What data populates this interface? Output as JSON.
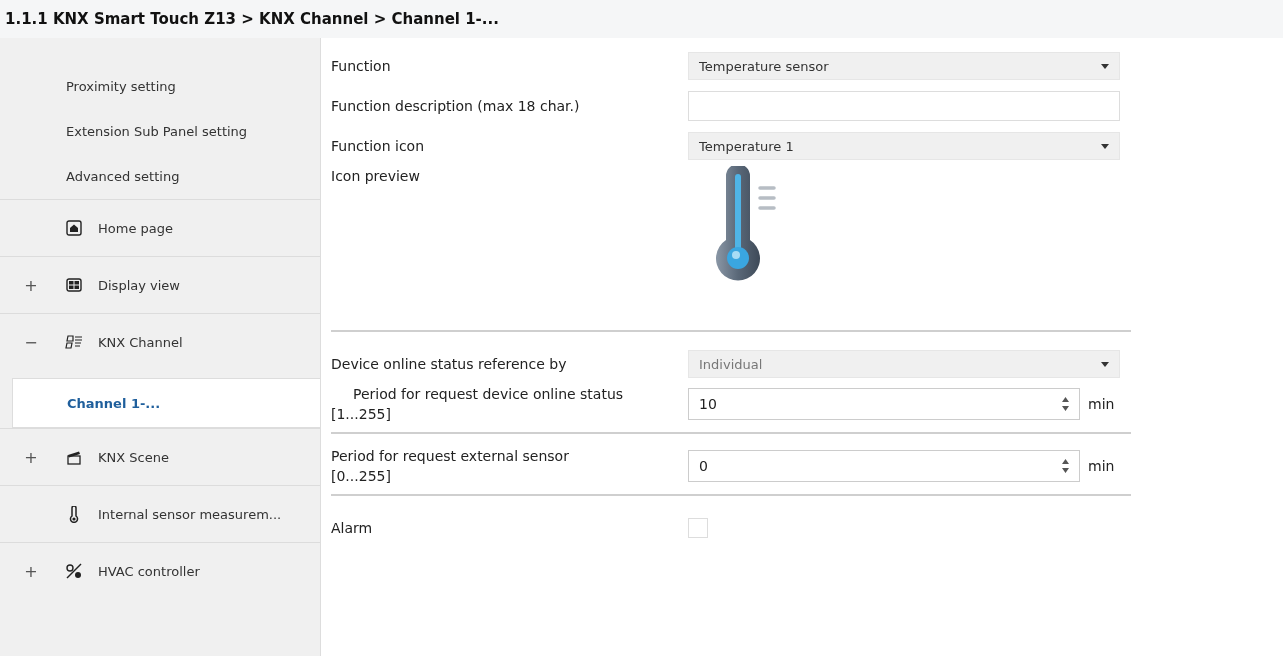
{
  "breadcrumb": "1.1.1 KNX Smart Touch Z13 > KNX Channel  > Channel 1-...",
  "sidebar": {
    "items": [
      {
        "kind": "sub",
        "label": "Proximity setting",
        "selected": false
      },
      {
        "kind": "sub",
        "label": "Extension Sub Panel setting",
        "selected": false
      },
      {
        "kind": "sub",
        "label": "Advanced setting",
        "selected": false
      },
      {
        "kind": "node",
        "label": "Home page",
        "selected": false
      },
      {
        "kind": "node",
        "label": "Display view",
        "expander": "+",
        "selected": false
      },
      {
        "kind": "node",
        "label": "KNX Channel",
        "expander": "−",
        "selected": false
      },
      {
        "kind": "sub",
        "label": "Channel 1-...",
        "selected": true
      },
      {
        "kind": "node",
        "label": "KNX Scene",
        "expander": "+",
        "selected": false
      },
      {
        "kind": "node",
        "label": "Internal sensor measurem...",
        "selected": false
      },
      {
        "kind": "node",
        "label": "HVAC controller",
        "expander": "+",
        "selected": false
      }
    ]
  },
  "sections": [
    [
      {
        "kind": "dropdown",
        "label": "Function",
        "value": "Temperature sensor",
        "disabled": false
      },
      {
        "kind": "text",
        "label": "Function description (max 18 char.)"
      },
      {
        "kind": "dropdown",
        "label": "Function icon",
        "value": "Temperature 1",
        "disabled": false
      },
      {
        "kind": "preview",
        "label": "Icon preview"
      }
    ],
    [
      {
        "kind": "dropdown",
        "label": "Device online status reference by",
        "value": "Individual",
        "disabled": true
      },
      {
        "kind": "number",
        "label": "Period for request device online status",
        "range": "[1...255]",
        "indent": true,
        "value": "10",
        "unit": "min"
      }
    ],
    [
      {
        "kind": "number",
        "label": "Period for request external sensor",
        "range": "[0...255]",
        "indent": false,
        "value": "0",
        "unit": "min"
      }
    ],
    [
      {
        "kind": "checkbox",
        "label": "Alarm",
        "checked": false
      }
    ]
  ]
}
